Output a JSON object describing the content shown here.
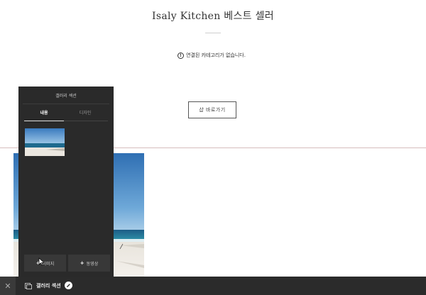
{
  "page": {
    "title": "Isaly Kitchen 베스트 셀러",
    "notice_text": "연결된 카테고리가 없습니다.",
    "shop_button_label": "샵 바로가기"
  },
  "panel": {
    "title": "갤러리 섹션",
    "tabs": [
      {
        "label": "내용",
        "active": true
      },
      {
        "label": "디자인",
        "active": false
      }
    ],
    "buttons": [
      {
        "label": "이미지"
      },
      {
        "label": "동영상"
      }
    ]
  },
  "bottom_bar": {
    "section_label": "갤러리 섹션"
  },
  "colors": {
    "panel_bg": "#2a2a2a",
    "bottom_bar_bg": "#2b2b2b",
    "divider": "#d6bdbd"
  },
  "icons": [
    "info-icon",
    "close-icon",
    "gallery-section-icon",
    "pencil-icon",
    "plus-icon",
    "mouse-cursor-icon"
  ]
}
